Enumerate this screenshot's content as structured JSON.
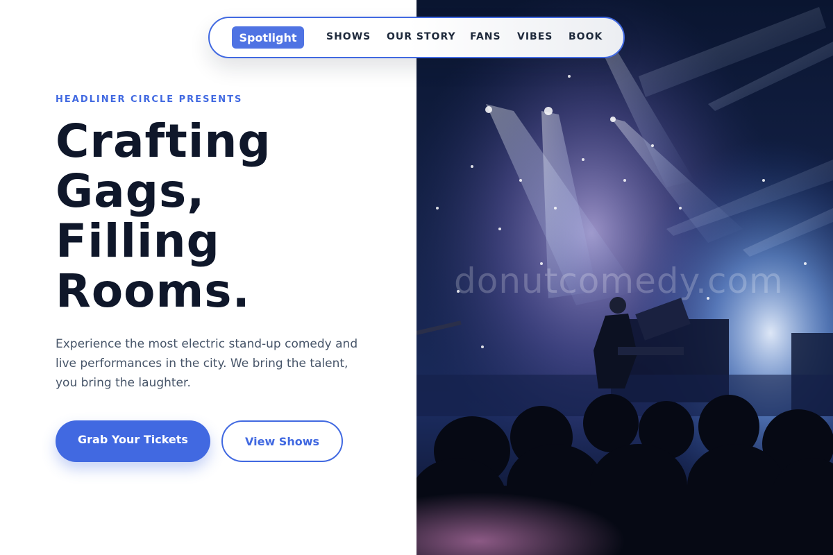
{
  "nav": {
    "active_label": "Spotlight",
    "items": [
      {
        "label": "SHOWS"
      },
      {
        "label": "OUR STORY"
      },
      {
        "label": "FANS"
      },
      {
        "label": "VIBES"
      },
      {
        "label": "BOOK"
      }
    ]
  },
  "hero": {
    "eyebrow": "HEADLINER CIRCLE PRESENTS",
    "headline_lines": [
      "Crafting",
      "Gags,",
      "Filling",
      "Rooms."
    ],
    "lede": "Experience the most electric stand-up comedy and live performances in the city. We bring the talent, you bring the laughter.",
    "primary_cta": "Grab Your Tickets",
    "secondary_cta": "View Shows"
  },
  "image": {
    "watermark": "donutcomedy.com"
  },
  "colors": {
    "accent": "#4169e1",
    "heading": "#0f172a",
    "body_text": "#475569"
  }
}
